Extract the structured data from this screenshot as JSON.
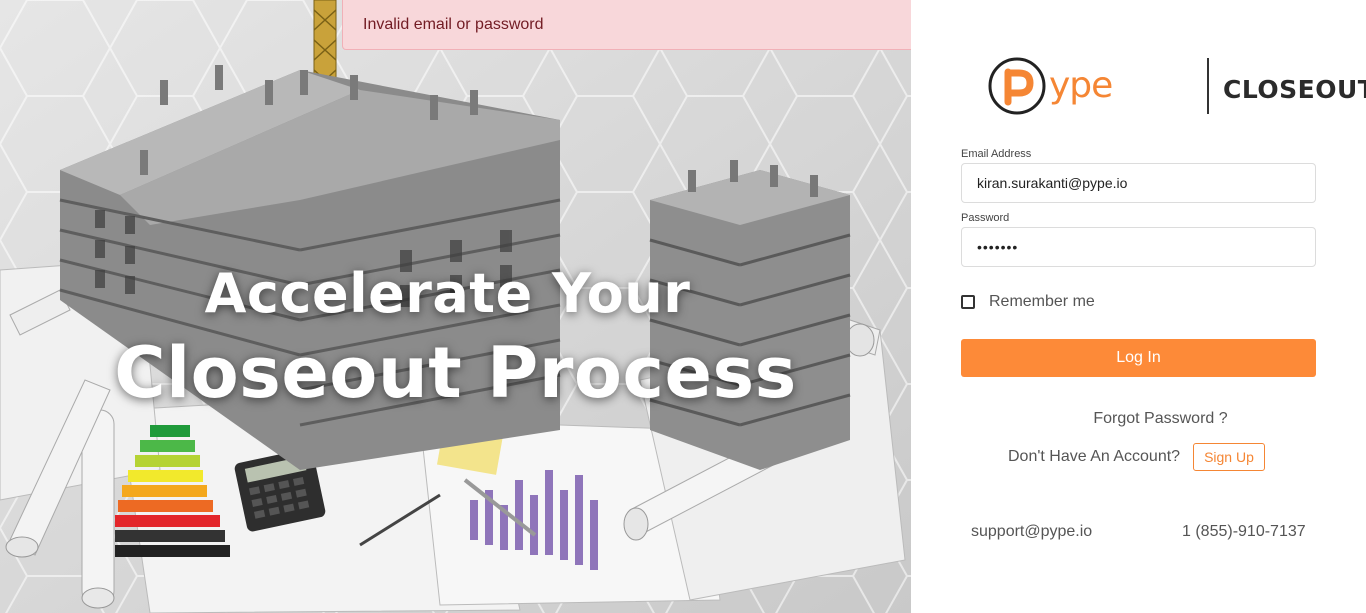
{
  "alert": {
    "message": "Invalid email or password",
    "close_symbol": "×"
  },
  "hero": {
    "line1": "Accelerate Your",
    "line2": "Closeout Process"
  },
  "brand": {
    "logo_letter": "P",
    "logo_rest": "ype",
    "product": "CLOSEOUT",
    "accent_color": "#f58634"
  },
  "form": {
    "email_label": "Email Address",
    "email_value": "kiran.surakanti@pype.io",
    "password_label": "Password",
    "password_value": "•••••••",
    "remember_label": "Remember me",
    "login_label": "Log In",
    "forgot_label": "Forgot Password ?",
    "no_account_label": "Don't Have An Account?",
    "signup_label": "Sign Up"
  },
  "support": {
    "email": "support@pype.io",
    "phone": "1 (855)-910-7137"
  }
}
